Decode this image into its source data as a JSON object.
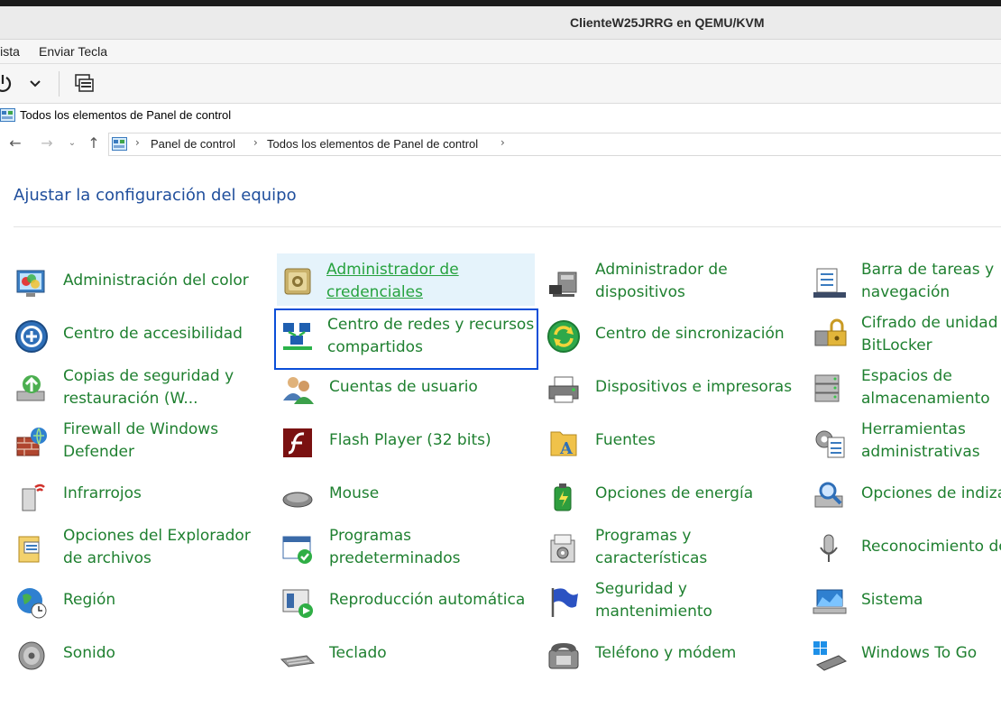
{
  "vm_window": {
    "title": "ClienteW25JRRG en QEMU/KVM"
  },
  "menu": [
    "Vista",
    "Enviar Tecla"
  ],
  "explorer": {
    "window_title": "Todos los elementos de Panel de control",
    "breadcrumb": [
      "Panel de control",
      "Todos los elementos de Panel de control"
    ]
  },
  "heading": "Ajustar la configuración del equipo",
  "colors": {
    "link_green": "#1f8030",
    "heading_blue": "#1f4e9c",
    "focus_blue": "#0a4ed8",
    "hover_bg": "#e5f3fb"
  },
  "items": [
    {
      "label1": "Administración del color",
      "label2": "",
      "icon": "color-management-icon"
    },
    {
      "label1": "Administrador de",
      "label2": "credenciales",
      "icon": "credential-manager-icon",
      "state": "hover"
    },
    {
      "label1": "Administrador de",
      "label2": "dispositivos",
      "icon": "device-manager-icon"
    },
    {
      "label1": "Barra de tareas y",
      "label2": "navegación",
      "icon": "taskbar-icon"
    },
    {
      "label1": "Centro de accesibilidad",
      "label2": "",
      "icon": "accessibility-icon"
    },
    {
      "label1": "Centro de redes y recursos",
      "label2": "compartidos",
      "icon": "network-center-icon",
      "state": "focus"
    },
    {
      "label1": "Centro de sincronización",
      "label2": "",
      "icon": "sync-center-icon"
    },
    {
      "label1": "Cifrado de unidad",
      "label2": "BitLocker",
      "icon": "bitlocker-icon"
    },
    {
      "label1": "Copias de seguridad y",
      "label2": "restauración (W...",
      "icon": "backup-icon"
    },
    {
      "label1": "Cuentas de usuario",
      "label2": "",
      "icon": "user-accounts-icon"
    },
    {
      "label1": "Dispositivos e impresoras",
      "label2": "",
      "icon": "printer-icon"
    },
    {
      "label1": "Espacios de",
      "label2": "almacenamiento",
      "icon": "storage-spaces-icon"
    },
    {
      "label1": "Firewall de Windows",
      "label2": "Defender",
      "icon": "firewall-icon"
    },
    {
      "label1": "Flash Player (32 bits)",
      "label2": "",
      "icon": "flash-player-icon"
    },
    {
      "label1": "Fuentes",
      "label2": "",
      "icon": "fonts-icon"
    },
    {
      "label1": "Herramientas",
      "label2": "administrativas",
      "icon": "admin-tools-icon"
    },
    {
      "label1": "Infrarrojos",
      "label2": "",
      "icon": "infrared-icon"
    },
    {
      "label1": "Mouse",
      "label2": "",
      "icon": "mouse-icon"
    },
    {
      "label1": "Opciones de energía",
      "label2": "",
      "icon": "power-options-icon"
    },
    {
      "label1": "Opciones de indizac",
      "label2": "",
      "icon": "indexing-icon"
    },
    {
      "label1": "Opciones del Explorador",
      "label2": "de archivos",
      "icon": "folder-options-icon"
    },
    {
      "label1": "Programas",
      "label2": "predeterminados",
      "icon": "default-programs-icon"
    },
    {
      "label1": "Programas y",
      "label2": "características",
      "icon": "programs-features-icon"
    },
    {
      "label1": "Reconocimiento de",
      "label2": "",
      "icon": "speech-recognition-icon"
    },
    {
      "label1": "Región",
      "label2": "",
      "icon": "region-icon"
    },
    {
      "label1": "Reproducción automática",
      "label2": "",
      "icon": "autoplay-icon"
    },
    {
      "label1": "Seguridad y",
      "label2": "mantenimiento",
      "icon": "security-maintenance-icon"
    },
    {
      "label1": "Sistema",
      "label2": "",
      "icon": "system-icon"
    },
    {
      "label1": "Sonido",
      "label2": "",
      "icon": "sound-icon"
    },
    {
      "label1": "Teclado",
      "label2": "",
      "icon": "keyboard-icon"
    },
    {
      "label1": "Teléfono y módem",
      "label2": "",
      "icon": "phone-modem-icon"
    },
    {
      "label1": "Windows To Go",
      "label2": "",
      "icon": "windows-to-go-icon"
    }
  ]
}
